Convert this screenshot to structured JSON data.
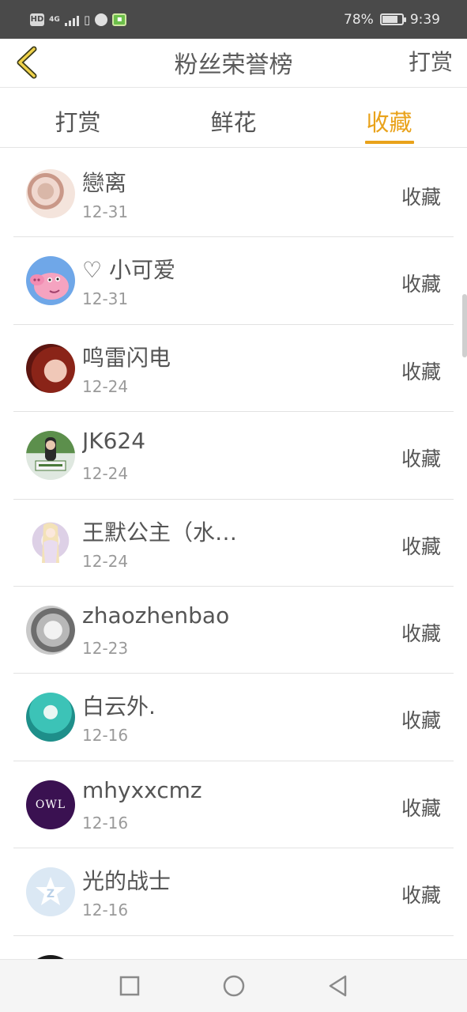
{
  "status_bar": {
    "hd_label": "HD",
    "network_label": "4G",
    "battery_percent_text": "78%",
    "battery_level": 0.78,
    "time": "9:39"
  },
  "header": {
    "back_icon": "chevron-left-icon",
    "title": "粉丝荣誉榜",
    "action_label": "打赏"
  },
  "tabs": [
    {
      "label": "打赏",
      "active": false
    },
    {
      "label": "鲜花",
      "active": false
    },
    {
      "label": "收藏",
      "active": true
    }
  ],
  "colors": {
    "accent": "#e9a21a",
    "status_bar_bg": "#4a4a4a",
    "text": "#555555",
    "subtext": "#9a9a9a"
  },
  "list": [
    {
      "name": "戀离",
      "date": "12-31",
      "action": "收藏"
    },
    {
      "name": "♡ 小可爱",
      "date": "12-31",
      "action": "收藏"
    },
    {
      "name": "鸣雷闪电",
      "date": "12-24",
      "action": "收藏"
    },
    {
      "name": "JK624",
      "date": "12-24",
      "action": "收藏"
    },
    {
      "name": "王默公主（水…",
      "date": "12-24",
      "action": "收藏"
    },
    {
      "name": "zhaozhenbao",
      "date": "12-23",
      "action": "收藏"
    },
    {
      "name": "白云外.",
      "date": "12-16",
      "action": "收藏"
    },
    {
      "name": "mhyxxcmz",
      "date": "12-16",
      "action": "收藏"
    },
    {
      "name": "光的战士",
      "date": "12-16",
      "action": "收藏"
    }
  ],
  "avatar_texts": {
    "owl": "OWL"
  },
  "navbar": {
    "icons": [
      "square-icon",
      "circle-icon",
      "triangle-back-icon"
    ]
  }
}
